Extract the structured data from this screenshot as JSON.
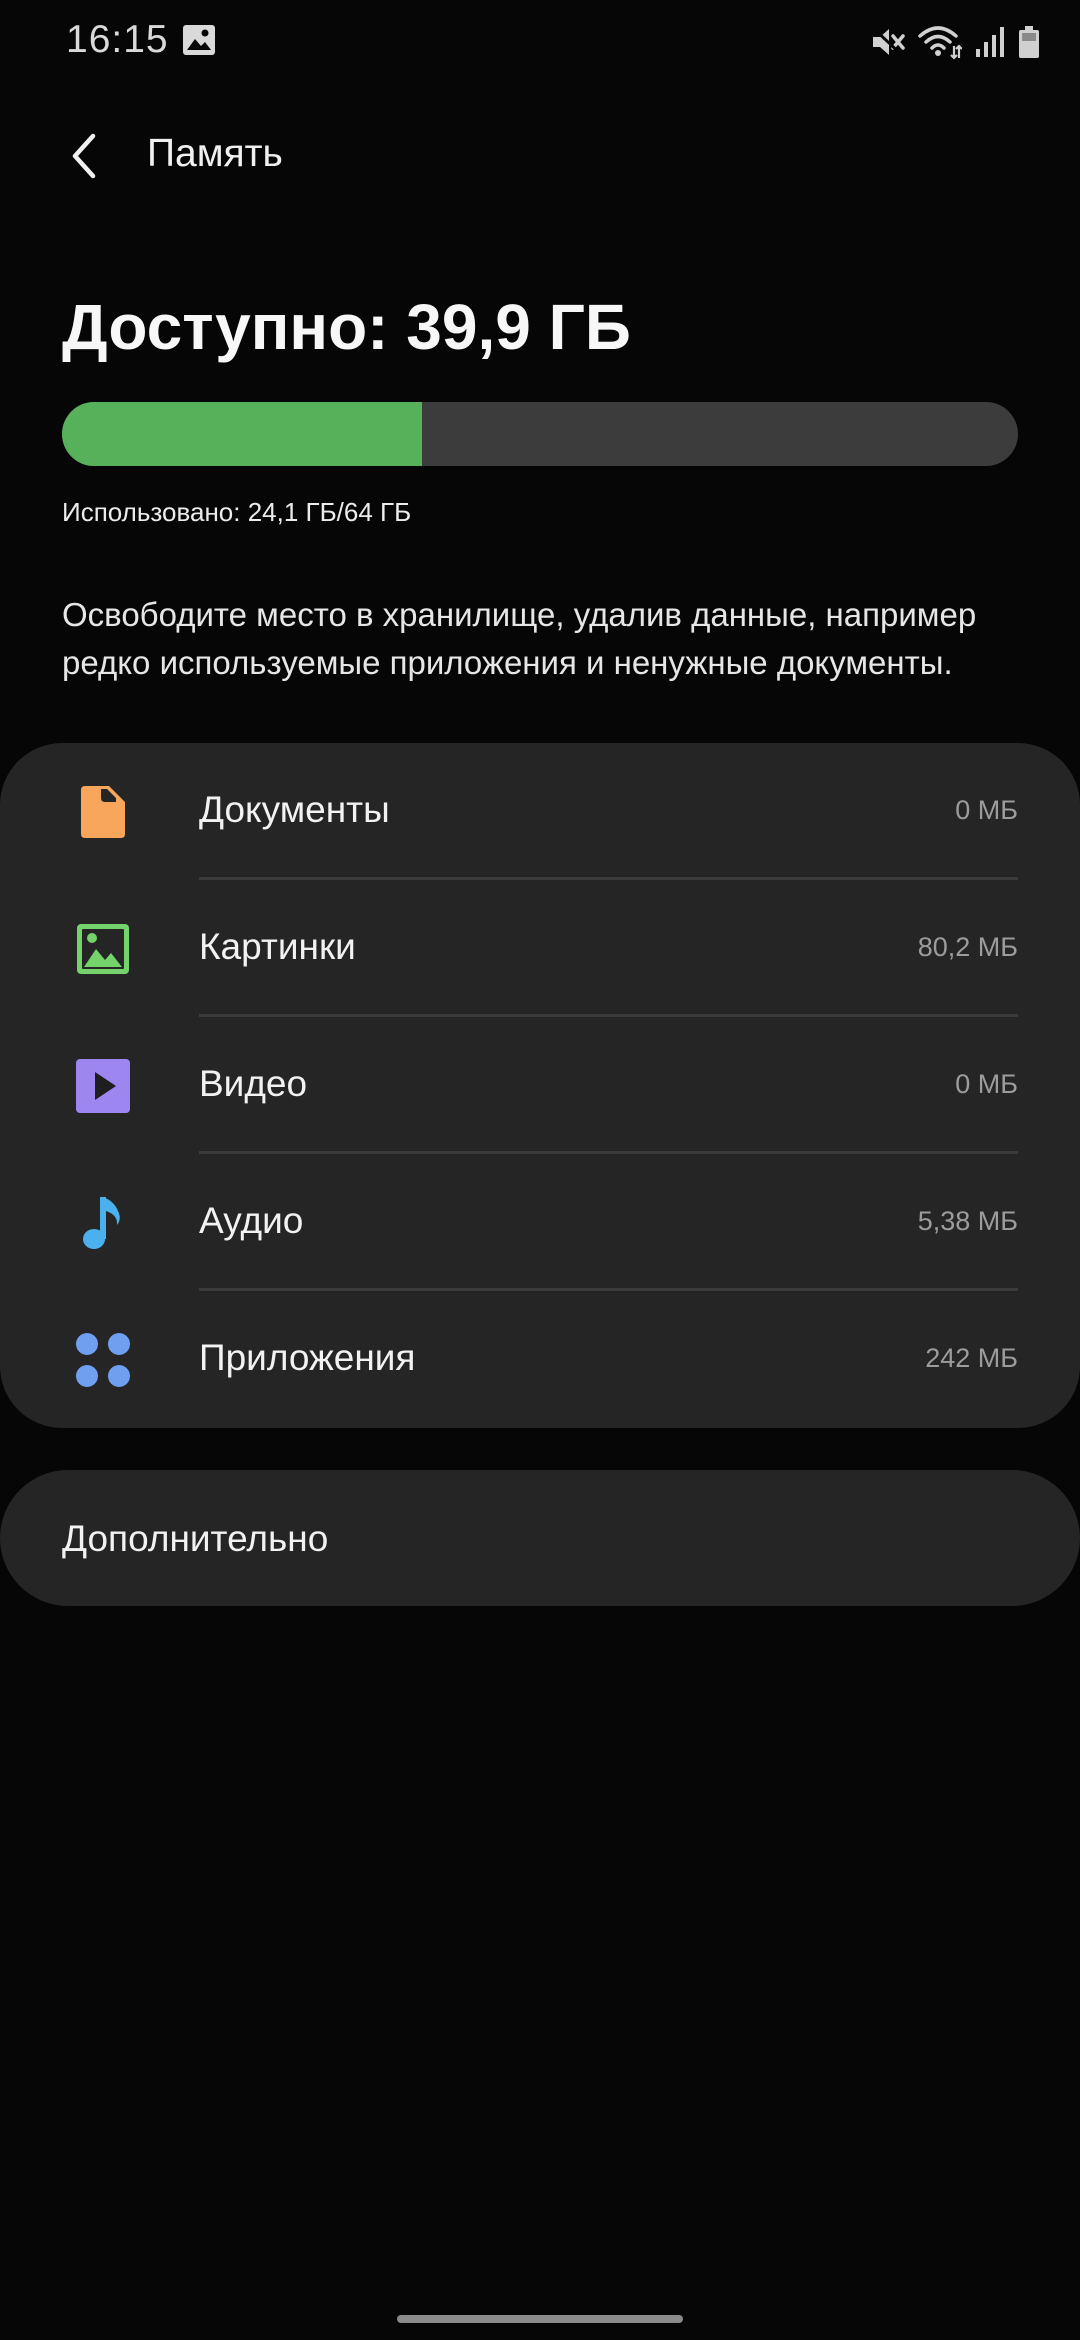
{
  "status_bar": {
    "time": "16:15",
    "icons": [
      "gallery-icon",
      "mute-icon",
      "wifi-icon",
      "signal-icon",
      "battery-icon"
    ]
  },
  "header": {
    "title": "Память",
    "back_icon": "chevron-left-icon"
  },
  "storage": {
    "available_label": "Доступно: 39,9 ГБ",
    "used_label": "Использовано: 24,1 ГБ/64 ГБ",
    "used_fraction": 0.377,
    "bar_color": "#56b15a"
  },
  "description": "Освободите место в хранилище, удалив данные, например редко используемые приложения и ненужные документы.",
  "categories": [
    {
      "label": "Документы",
      "size": "0 МБ",
      "icon": "document-icon",
      "color": "#f7a65b"
    },
    {
      "label": "Картинки",
      "size": "80,2 МБ",
      "icon": "image-icon",
      "color": "#74d36b"
    },
    {
      "label": "Видео",
      "size": "0 МБ",
      "icon": "video-icon",
      "color": "#9d86f0"
    },
    {
      "label": "Аудио",
      "size": "5,38 МБ",
      "icon": "music-note-icon",
      "color": "#4bb0ee"
    },
    {
      "label": "Приложения",
      "size": "242 МБ",
      "icon": "apps-icon",
      "color": "#6e9ff0"
    }
  ],
  "additional": {
    "label": "Дополнительно"
  }
}
